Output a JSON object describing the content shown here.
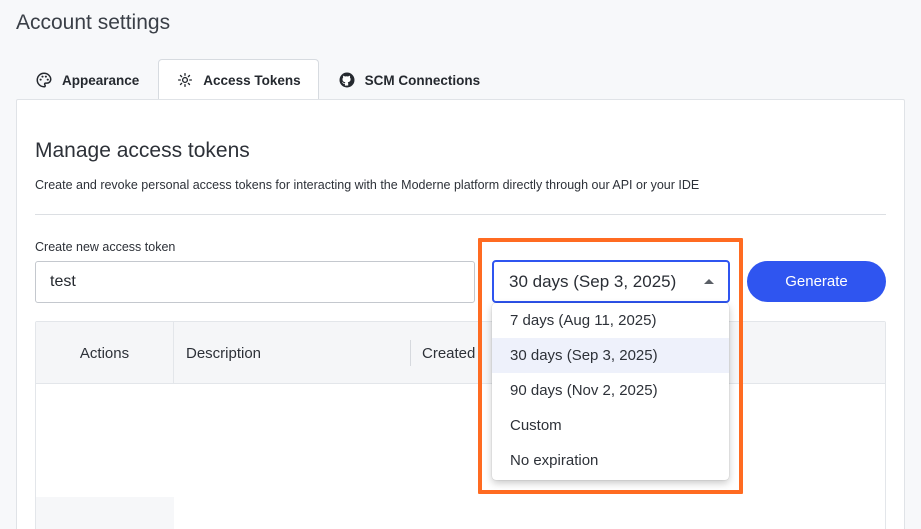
{
  "page": {
    "title": "Account settings"
  },
  "tabs": [
    {
      "label": "Appearance",
      "icon": "palette-icon",
      "active": false
    },
    {
      "label": "Access Tokens",
      "icon": "token-icon",
      "active": true
    },
    {
      "label": "SCM Connections",
      "icon": "github-icon",
      "active": false
    }
  ],
  "section": {
    "title": "Manage access tokens",
    "description": "Create and revoke personal access tokens for interacting with the Moderne platform directly through our API or your IDE"
  },
  "form": {
    "label": "Create new access token",
    "input_value": "test",
    "expiration_selected": "30 days (Sep 3, 2025)",
    "generate_label": "Generate"
  },
  "dropdown": {
    "options": [
      "7 days (Aug 11, 2025)",
      "30 days (Sep 3, 2025)",
      "90 days (Nov 2, 2025)",
      "Custom",
      "No expiration"
    ],
    "selected_index": 1
  },
  "table": {
    "columns": [
      "Actions",
      "Description",
      "Created"
    ]
  },
  "colors": {
    "accent": "#2f55f0",
    "highlight": "#ff6b21",
    "selected_option_bg": "#eef1fb"
  }
}
